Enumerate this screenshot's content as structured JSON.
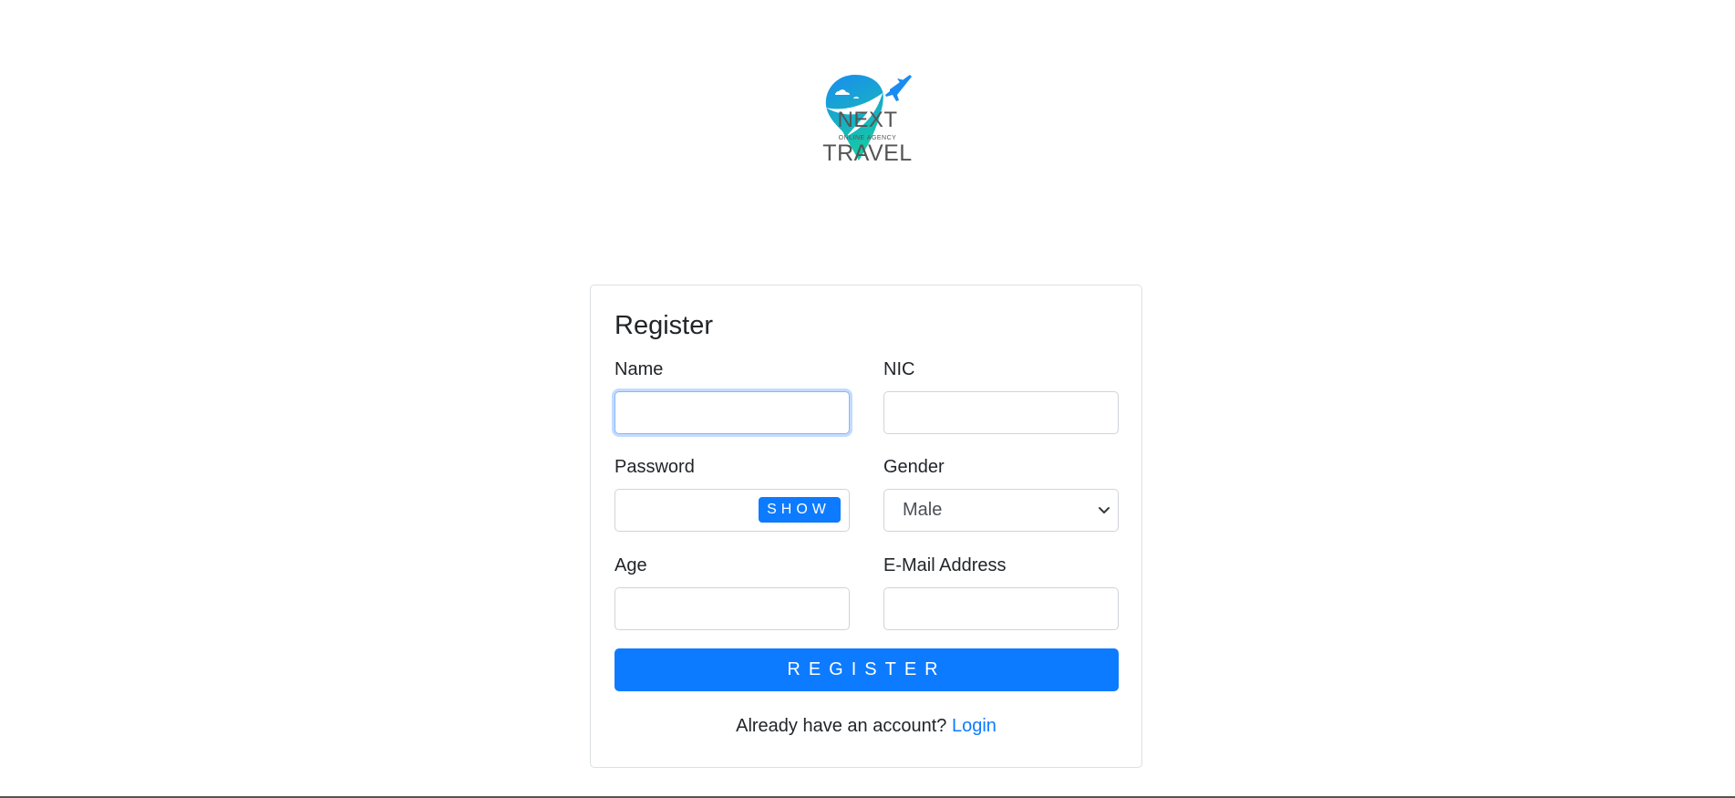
{
  "brand": {
    "line1": "NEXT",
    "tagline": "ONLINE AGENCY",
    "line2": "TRAVEL",
    "colors": {
      "blue": "#1a8cf0",
      "teal": "#15c9a4"
    }
  },
  "form": {
    "title": "Register",
    "fields": {
      "name": {
        "label": "Name",
        "value": ""
      },
      "nic": {
        "label": "NIC",
        "value": ""
      },
      "password": {
        "label": "Password",
        "value": "",
        "toggle_label": "SHOW"
      },
      "gender": {
        "label": "Gender",
        "selected": "Male"
      },
      "age": {
        "label": "Age",
        "value": ""
      },
      "email": {
        "label": "E-Mail Address",
        "value": ""
      }
    },
    "submit_label": "REGISTER",
    "footer_text": "Already have an account?",
    "login_link": "Login"
  },
  "accent_color": "#0d7bff"
}
